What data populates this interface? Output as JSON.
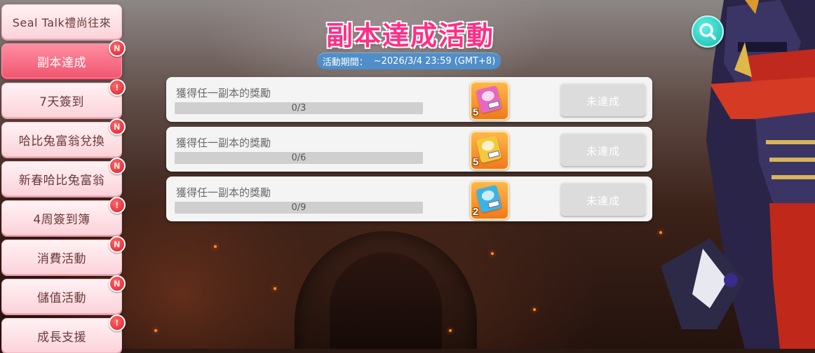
{
  "title": "副本達成活動",
  "period": {
    "label": "活動期間：",
    "value": "~2026/3/4 23:59 (GMT+8)"
  },
  "colors": {
    "title": "#ff2f86",
    "active_tab": "#f0566f",
    "period_bg": "#4f8ec9",
    "badge": "#e01c2c"
  },
  "menu": [
    {
      "label": "Seal Talk禮尚往來",
      "badge": "",
      "active": false
    },
    {
      "label": "副本達成",
      "badge": "N",
      "active": true
    },
    {
      "label": "7天簽到",
      "badge": "!",
      "active": false
    },
    {
      "label": "哈比兔富翁兌換",
      "badge": "N",
      "active": false
    },
    {
      "label": "新春哈比兔富翁",
      "badge": "N",
      "active": false
    },
    {
      "label": "4周簽到簿",
      "badge": "!",
      "active": false
    },
    {
      "label": "消費活動",
      "badge": "N",
      "active": false
    },
    {
      "label": "儲值活動",
      "badge": "N",
      "active": false
    },
    {
      "label": "成長支援",
      "badge": "!",
      "active": false
    }
  ],
  "quests": [
    {
      "title": "獲得任一副本的獎勵",
      "progress_text": "0/3",
      "progress": 0,
      "reward_icon": "pink-ticket-icon",
      "reward_qty": "5",
      "status": "未達成"
    },
    {
      "title": "獲得任一副本的獎勵",
      "progress_text": "0/6",
      "progress": 0,
      "reward_icon": "yellow-ticket-icon",
      "reward_qty": "5",
      "status": "未達成"
    },
    {
      "title": "獲得任一副本的獎勵",
      "progress_text": "0/9",
      "progress": 0,
      "reward_icon": "blue-ticket-icon",
      "reward_qty": "2",
      "status": "未達成"
    }
  ],
  "search": {
    "icon": "search-icon"
  }
}
